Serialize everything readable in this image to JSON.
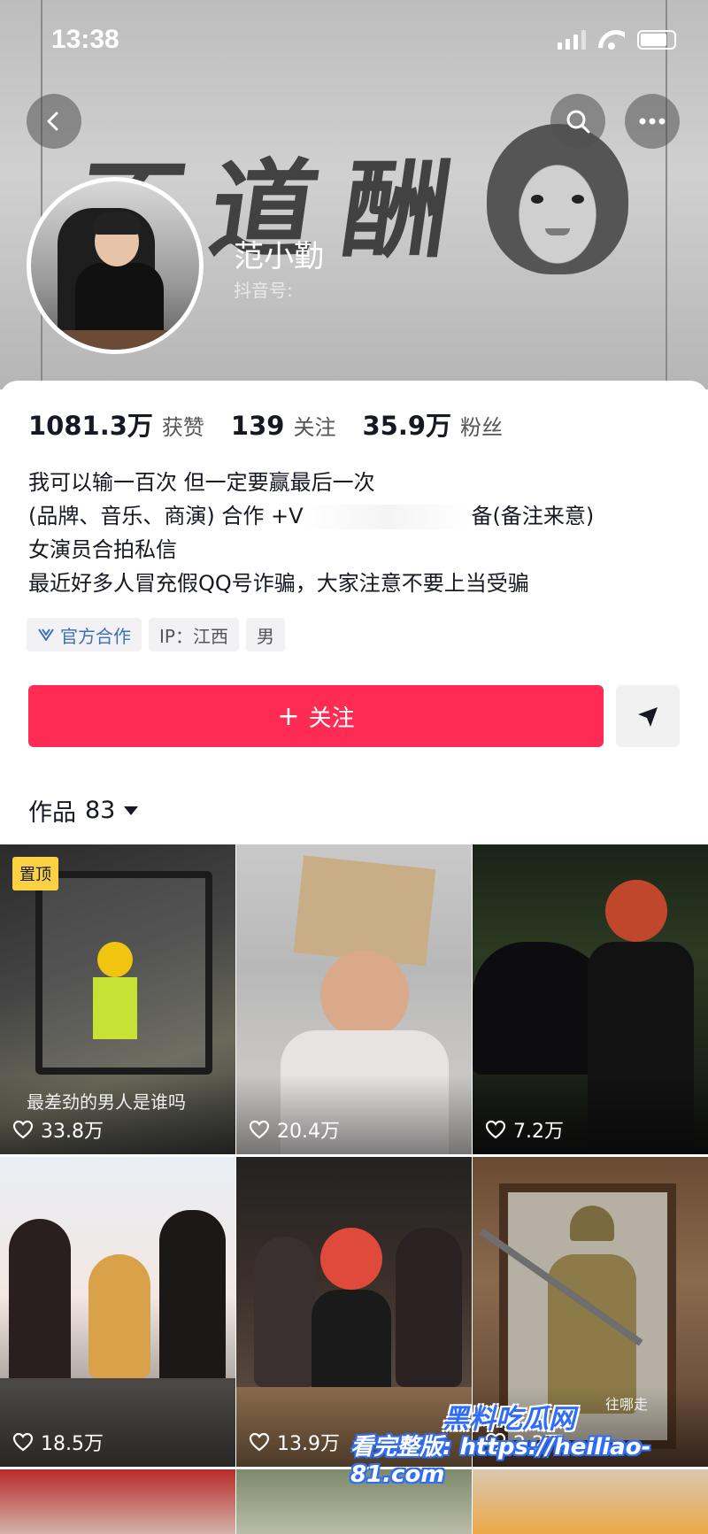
{
  "status_bar": {
    "time": "13:38"
  },
  "profile": {
    "banner_text": "不道酬",
    "nickname": "范小勤",
    "douyin_id_label": "抖音号:"
  },
  "stats": [
    {
      "value": "1081.3万",
      "label": "获赞"
    },
    {
      "value": "139",
      "label": "关注"
    },
    {
      "value": "35.9万",
      "label": "粉丝"
    }
  ],
  "bio": {
    "line1": "我可以输一百次 但一定要赢最后一次",
    "line2_start": "(品牌、音乐、商演) 合作 +V",
    "line2_end": "备(备注来意)",
    "line3": "女演员合拍私信",
    "line4": "最近好多人冒充假QQ号诈骗，大家注意不要上当受骗"
  },
  "tags": {
    "official": "官方合作",
    "ip": "IP：江西",
    "gender": "男"
  },
  "actions": {
    "follow_label": "关注",
    "follow_plus": "+"
  },
  "works": {
    "label": "作品",
    "count": "83"
  },
  "videos": [
    {
      "likes": "33.8万",
      "pinned_label": "置顶",
      "caption": "最差劲的男人是谁吗"
    },
    {
      "likes": "20.4万"
    },
    {
      "likes": "7.2万"
    },
    {
      "likes": "18.5万"
    },
    {
      "likes": "13.9万"
    },
    {
      "likes": "2.2万",
      "caption": "往哪走"
    }
  ],
  "watermark": {
    "brand": "黑料吃瓜网",
    "line": "看完整版: https://heiliao-81.com"
  },
  "colors": {
    "accent": "#fe2c55",
    "pin": "#fbd243",
    "official": "#3b6fb8"
  }
}
